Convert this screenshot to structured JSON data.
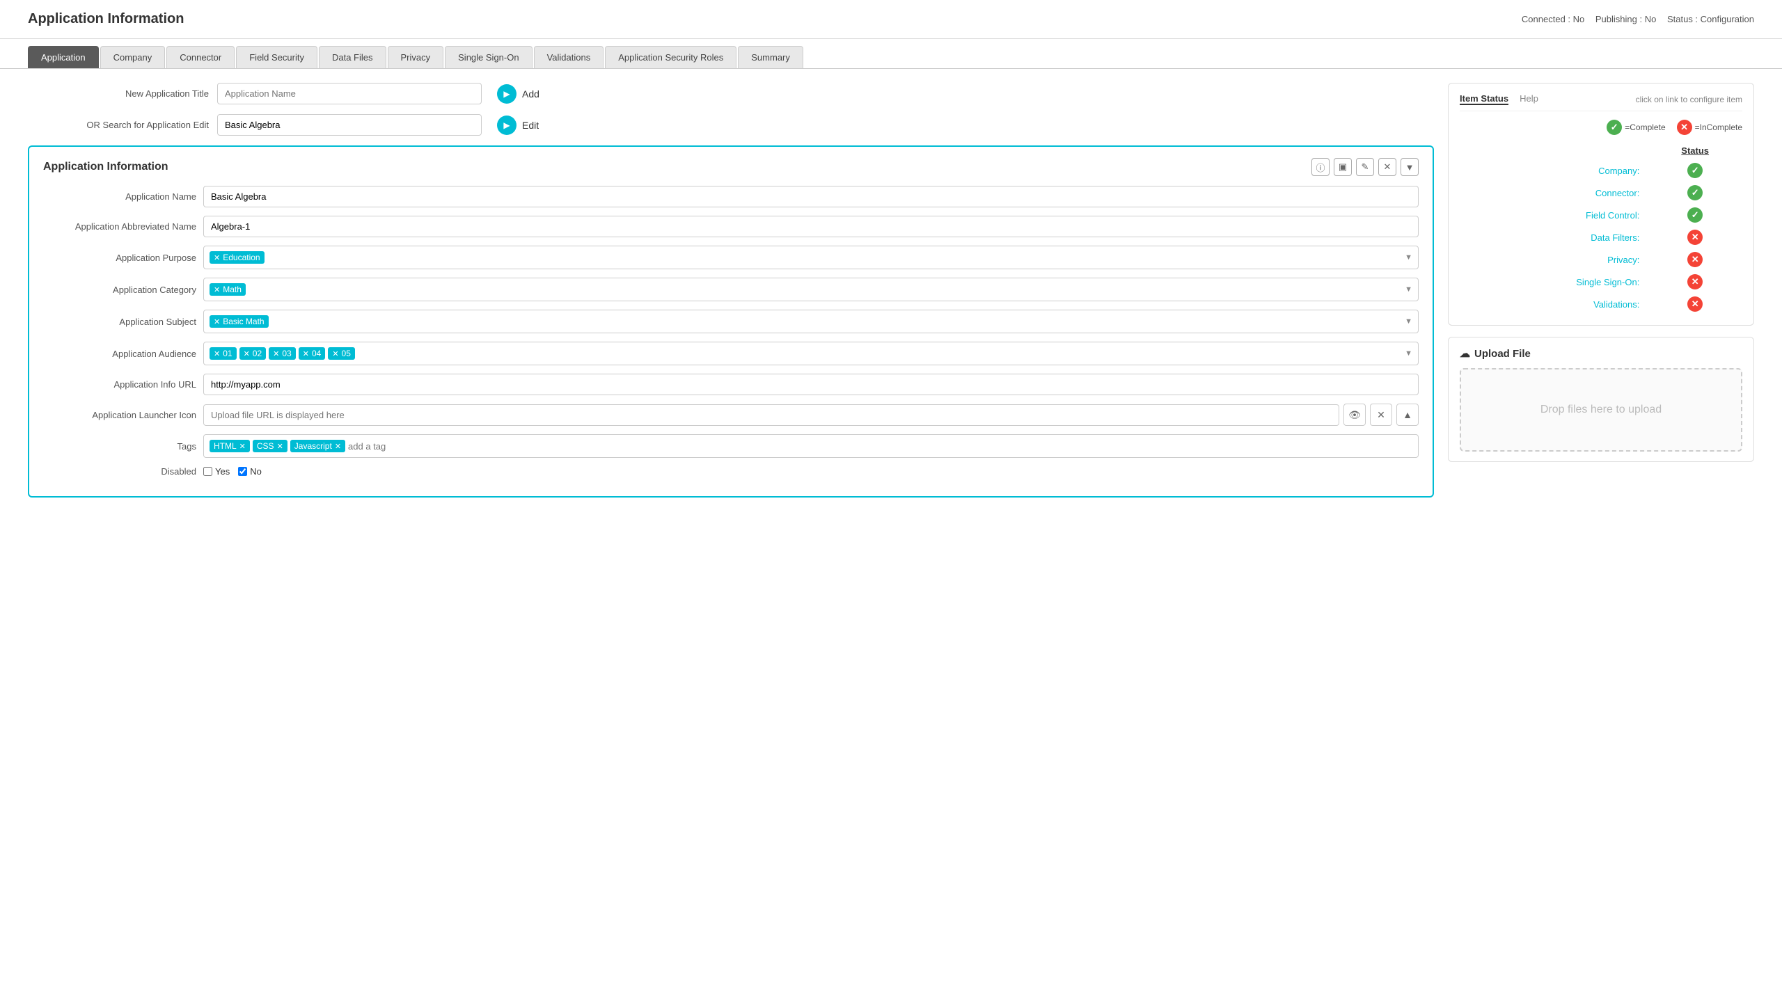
{
  "header": {
    "title": "Application Information",
    "status_connected": "Connected : No",
    "status_publishing": "Publishing : No",
    "status_config": "Status : Configuration"
  },
  "tabs": [
    {
      "label": "Application",
      "active": true
    },
    {
      "label": "Company",
      "active": false
    },
    {
      "label": "Connector",
      "active": false
    },
    {
      "label": "Field Security",
      "active": false
    },
    {
      "label": "Data Files",
      "active": false
    },
    {
      "label": "Privacy",
      "active": false
    },
    {
      "label": "Single Sign-On",
      "active": false
    },
    {
      "label": "Validations",
      "active": false
    },
    {
      "label": "Application Security Roles",
      "active": false
    },
    {
      "label": "Summary",
      "active": false
    }
  ],
  "new_app_label": "New Application Title",
  "new_app_placeholder": "Application Name",
  "search_label": "OR Search for Application Edit",
  "search_value": "Basic Algebra",
  "btn_add": "Add",
  "btn_edit": "Edit",
  "info_box": {
    "title": "Application Information",
    "fields": {
      "name_label": "Application Name",
      "name_value": "Basic Algebra",
      "abbr_label": "Application Abbreviated Name",
      "abbr_value": "Algebra-1",
      "purpose_label": "Application Purpose",
      "purpose_tags": [
        {
          "label": "Education"
        }
      ],
      "category_label": "Application Category",
      "category_tags": [
        {
          "label": "Math"
        }
      ],
      "subject_label": "Application Subject",
      "subject_tags": [
        {
          "label": "Basic Math"
        }
      ],
      "audience_label": "Application Audience",
      "audience_tags": [
        {
          "label": "01"
        },
        {
          "label": "02"
        },
        {
          "label": "03"
        },
        {
          "label": "04"
        },
        {
          "label": "05"
        }
      ],
      "info_url_label": "Application Info URL",
      "info_url_value": "http://myapp.com",
      "launcher_icon_label": "Application Launcher Icon",
      "launcher_icon_placeholder": "Upload file URL is displayed here",
      "tags_label": "Tags",
      "tags": [
        {
          "label": "HTML"
        },
        {
          "label": "CSS"
        },
        {
          "label": "Javascript"
        }
      ],
      "add_tag_placeholder": "add a tag",
      "disabled_label": "Disabled",
      "yes_label": "Yes",
      "no_label": "No"
    }
  },
  "status_panel": {
    "tab_status": "Item Status",
    "tab_help": "Help",
    "configure_text": "click on link to configure item",
    "status_col_header": "Status",
    "legend_complete": "=Complete",
    "legend_incomplete": "=InComplete",
    "items": [
      {
        "name": "Company:",
        "complete": true
      },
      {
        "name": "Connector:",
        "complete": true
      },
      {
        "name": "Field Control:",
        "complete": true
      },
      {
        "name": "Data Filters:",
        "complete": false
      },
      {
        "name": "Privacy:",
        "complete": false
      },
      {
        "name": "Single Sign-On:",
        "complete": false
      },
      {
        "name": "Validations:",
        "complete": false
      }
    ]
  },
  "upload_panel": {
    "title": "Upload File",
    "drop_text": "Drop files here to upload"
  }
}
